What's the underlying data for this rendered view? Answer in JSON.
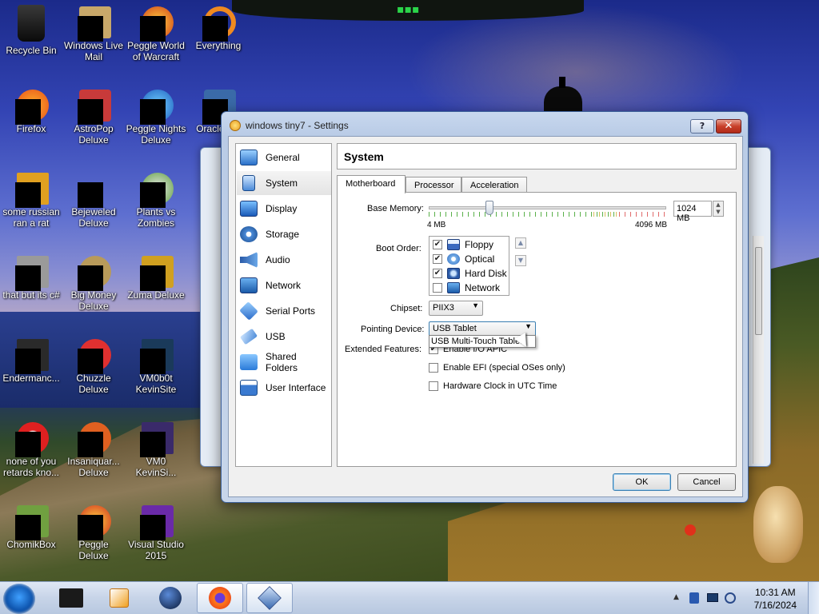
{
  "desktop": {
    "icons": [
      {
        "label": "Recycle Bin"
      },
      {
        "label": "Windows Live Mail"
      },
      {
        "label": "Peggle World of Warcraft"
      },
      {
        "label": "Everything"
      },
      {
        "label": "Firefox"
      },
      {
        "label": "AstroPop Deluxe"
      },
      {
        "label": "Peggle Nights Deluxe"
      },
      {
        "label": "Oracle V..."
      },
      {
        "label": "some russian ran a rat"
      },
      {
        "label": "Bejeweled Deluxe"
      },
      {
        "label": "Plants vs Zombies"
      },
      {
        "label": "that but its c#"
      },
      {
        "label": "Big Money Deluxe"
      },
      {
        "label": "Zuma Deluxe"
      },
      {
        "label": "Endermanc..."
      },
      {
        "label": "Chuzzle Deluxe"
      },
      {
        "label": "VM0b0t KevinSite"
      },
      {
        "label": "none of you retards kno..."
      },
      {
        "label": "Insaniquar... Deluxe"
      },
      {
        "label": "VM0 KevinSi..."
      },
      {
        "label": "ChomikBox"
      },
      {
        "label": "Peggle Deluxe"
      },
      {
        "label": "Visual Studio 2015"
      }
    ]
  },
  "dialog": {
    "title": "windows tiny7 - Settings",
    "help_label": "?",
    "close_label": "✕",
    "sidebar": [
      {
        "label": "General",
        "icon": "general-icon"
      },
      {
        "label": "System",
        "icon": "system-icon",
        "selected": true
      },
      {
        "label": "Display",
        "icon": "display-icon"
      },
      {
        "label": "Storage",
        "icon": "storage-icon"
      },
      {
        "label": "Audio",
        "icon": "audio-icon"
      },
      {
        "label": "Network",
        "icon": "network-icon"
      },
      {
        "label": "Serial Ports",
        "icon": "serial-ports-icon"
      },
      {
        "label": "USB",
        "icon": "usb-icon"
      },
      {
        "label": "Shared Folders",
        "icon": "shared-folders-icon"
      },
      {
        "label": "User Interface",
        "icon": "user-interface-icon"
      }
    ],
    "panel_title": "System",
    "tabs": [
      "Motherboard",
      "Processor",
      "Acceleration"
    ],
    "motherboard": {
      "base_memory_label": "Base Memory:",
      "base_memory_value": "1024 MB",
      "base_memory_min": "4 MB",
      "base_memory_max": "4096 MB",
      "boot_order_label": "Boot Order:",
      "boot_items": [
        {
          "label": "Floppy",
          "checked": "✔"
        },
        {
          "label": "Optical",
          "checked": "✔"
        },
        {
          "label": "Hard Disk",
          "checked": "✔"
        },
        {
          "label": "Network",
          "checked": ""
        }
      ],
      "chipset_label": "Chipset:",
      "chipset_value": "PIIX3",
      "pointing_label": "Pointing Device:",
      "pointing_value": "USB Tablet",
      "pointing_option_hover": "USB Multi-Touch Tablet",
      "extended_label": "Extended Features:",
      "features": [
        {
          "label": "Enable I/O APIC",
          "checked": "✔"
        },
        {
          "label": "Enable EFI (special OSes only)",
          "checked": ""
        },
        {
          "label": "Hardware Clock in UTC Time",
          "checked": ""
        }
      ]
    },
    "ok_label": "OK",
    "cancel_label": "Cancel"
  },
  "taskbar": {
    "time": "10:31 AM",
    "date": "7/16/2024"
  }
}
